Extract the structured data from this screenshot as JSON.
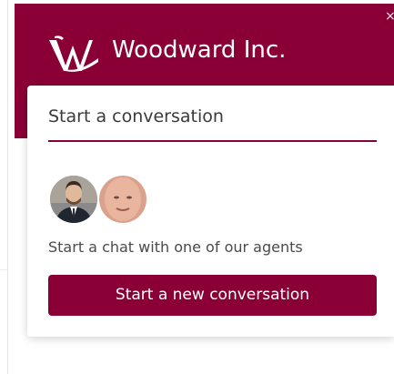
{
  "theme": {
    "brand_color": "#8a0036"
  },
  "header": {
    "logo_icon": "woodward-logo",
    "company_name": "Woodward Inc.",
    "close_icon": "close-icon",
    "close_glyph": "×"
  },
  "card": {
    "title": "Start a conversation",
    "agents": [
      {
        "avatar": "agent-avatar-1"
      },
      {
        "avatar": "agent-avatar-2"
      }
    ],
    "agents_text": "Start a chat with one of our agents",
    "cta_label": "Start a new conversation"
  }
}
